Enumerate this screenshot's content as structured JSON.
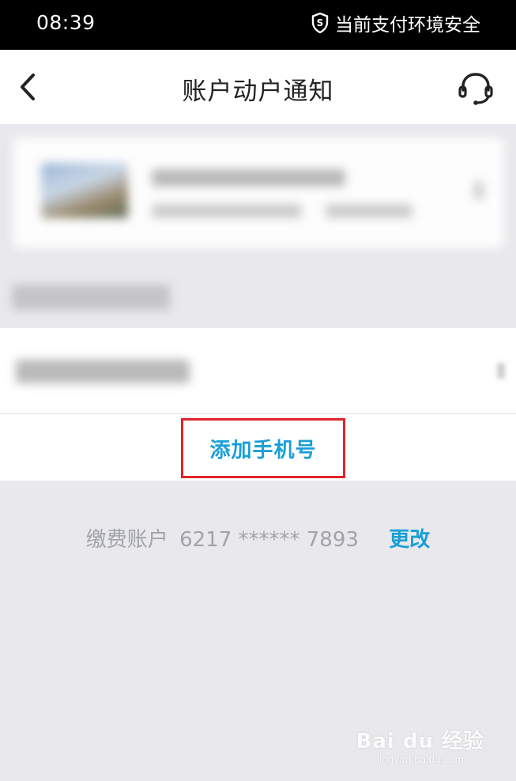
{
  "status_bar": {
    "time": "08:39",
    "security_text": "当前支付环境安全",
    "icon": "shield-icon"
  },
  "header": {
    "title": "账户动户通知",
    "back_icon": "chevron-left-icon",
    "service_icon": "headset-icon"
  },
  "list": {
    "add_phone_label": "添加手机号"
  },
  "payment": {
    "label": "缴费账户",
    "account_masked": "6217 ****** 7893",
    "change_label": "更改"
  },
  "watermark": {
    "brand": "Bai du 经验",
    "url": "jingyan.baidu.com"
  },
  "colors": {
    "accent": "#1a9fd6",
    "highlight_border": "#e0232b",
    "background": "#e9e9ed"
  }
}
